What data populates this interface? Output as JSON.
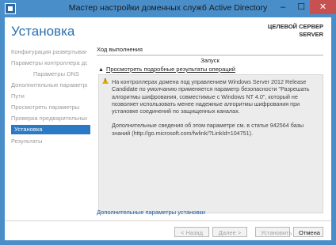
{
  "window": {
    "title": "Мастер настройки доменных служб Active Directory",
    "minimize": "–",
    "maximize": "☐",
    "close": "✕"
  },
  "header": {
    "page_title": "Установка",
    "target_label": "ЦЕЛЕВОЙ СЕРВЕР",
    "target_value": "SERVER"
  },
  "sidebar": {
    "items": [
      {
        "label": "Конфигурация развертывания",
        "state": "normal"
      },
      {
        "label": "Параметры контроллера домена",
        "state": "normal"
      },
      {
        "label": "Параметры DNS",
        "state": "normal",
        "indent": true
      },
      {
        "label": "Дополнительные параметры",
        "state": "normal"
      },
      {
        "label": "Пути",
        "state": "normal"
      },
      {
        "label": "Просмотреть параметры",
        "state": "normal"
      },
      {
        "label": "Проверка предварительных требований",
        "state": "normal"
      },
      {
        "label": "Установка",
        "state": "active"
      },
      {
        "label": "Результаты",
        "state": "normal"
      }
    ]
  },
  "progress": {
    "label": "Ход выполнения",
    "fraction": 0.0,
    "status": "Запуск"
  },
  "details": {
    "toggle_label": "Просмотреть подробные результаты операций",
    "caret": "▲",
    "messages": [
      "На контроллерах домена под управлением Windows Server 2012 Release Candidate по умолчанию применяется параметр безопасности \"Разрешать алгоритмы шифрования, совместимые с Windows NT 4.0\", который не позволяет использовать менее надежные алгоритмы шифрования при установке соединений по защищенных каналах.",
      "Дополнительные сведения об этом параметре см. в статье 942564 базы знаний (http://go.microsoft.com/fwlink/?LinkId=104751)."
    ]
  },
  "extra_link": "Дополнительные параметры установки",
  "buttons": {
    "back": "< Назад",
    "next": "Далее >",
    "install": "Установить",
    "cancel": "Отмена"
  },
  "colors": {
    "accent": "#2b78c4",
    "frame": "#4a8ec9",
    "close": "#c75050",
    "warning": "#e0b000"
  }
}
